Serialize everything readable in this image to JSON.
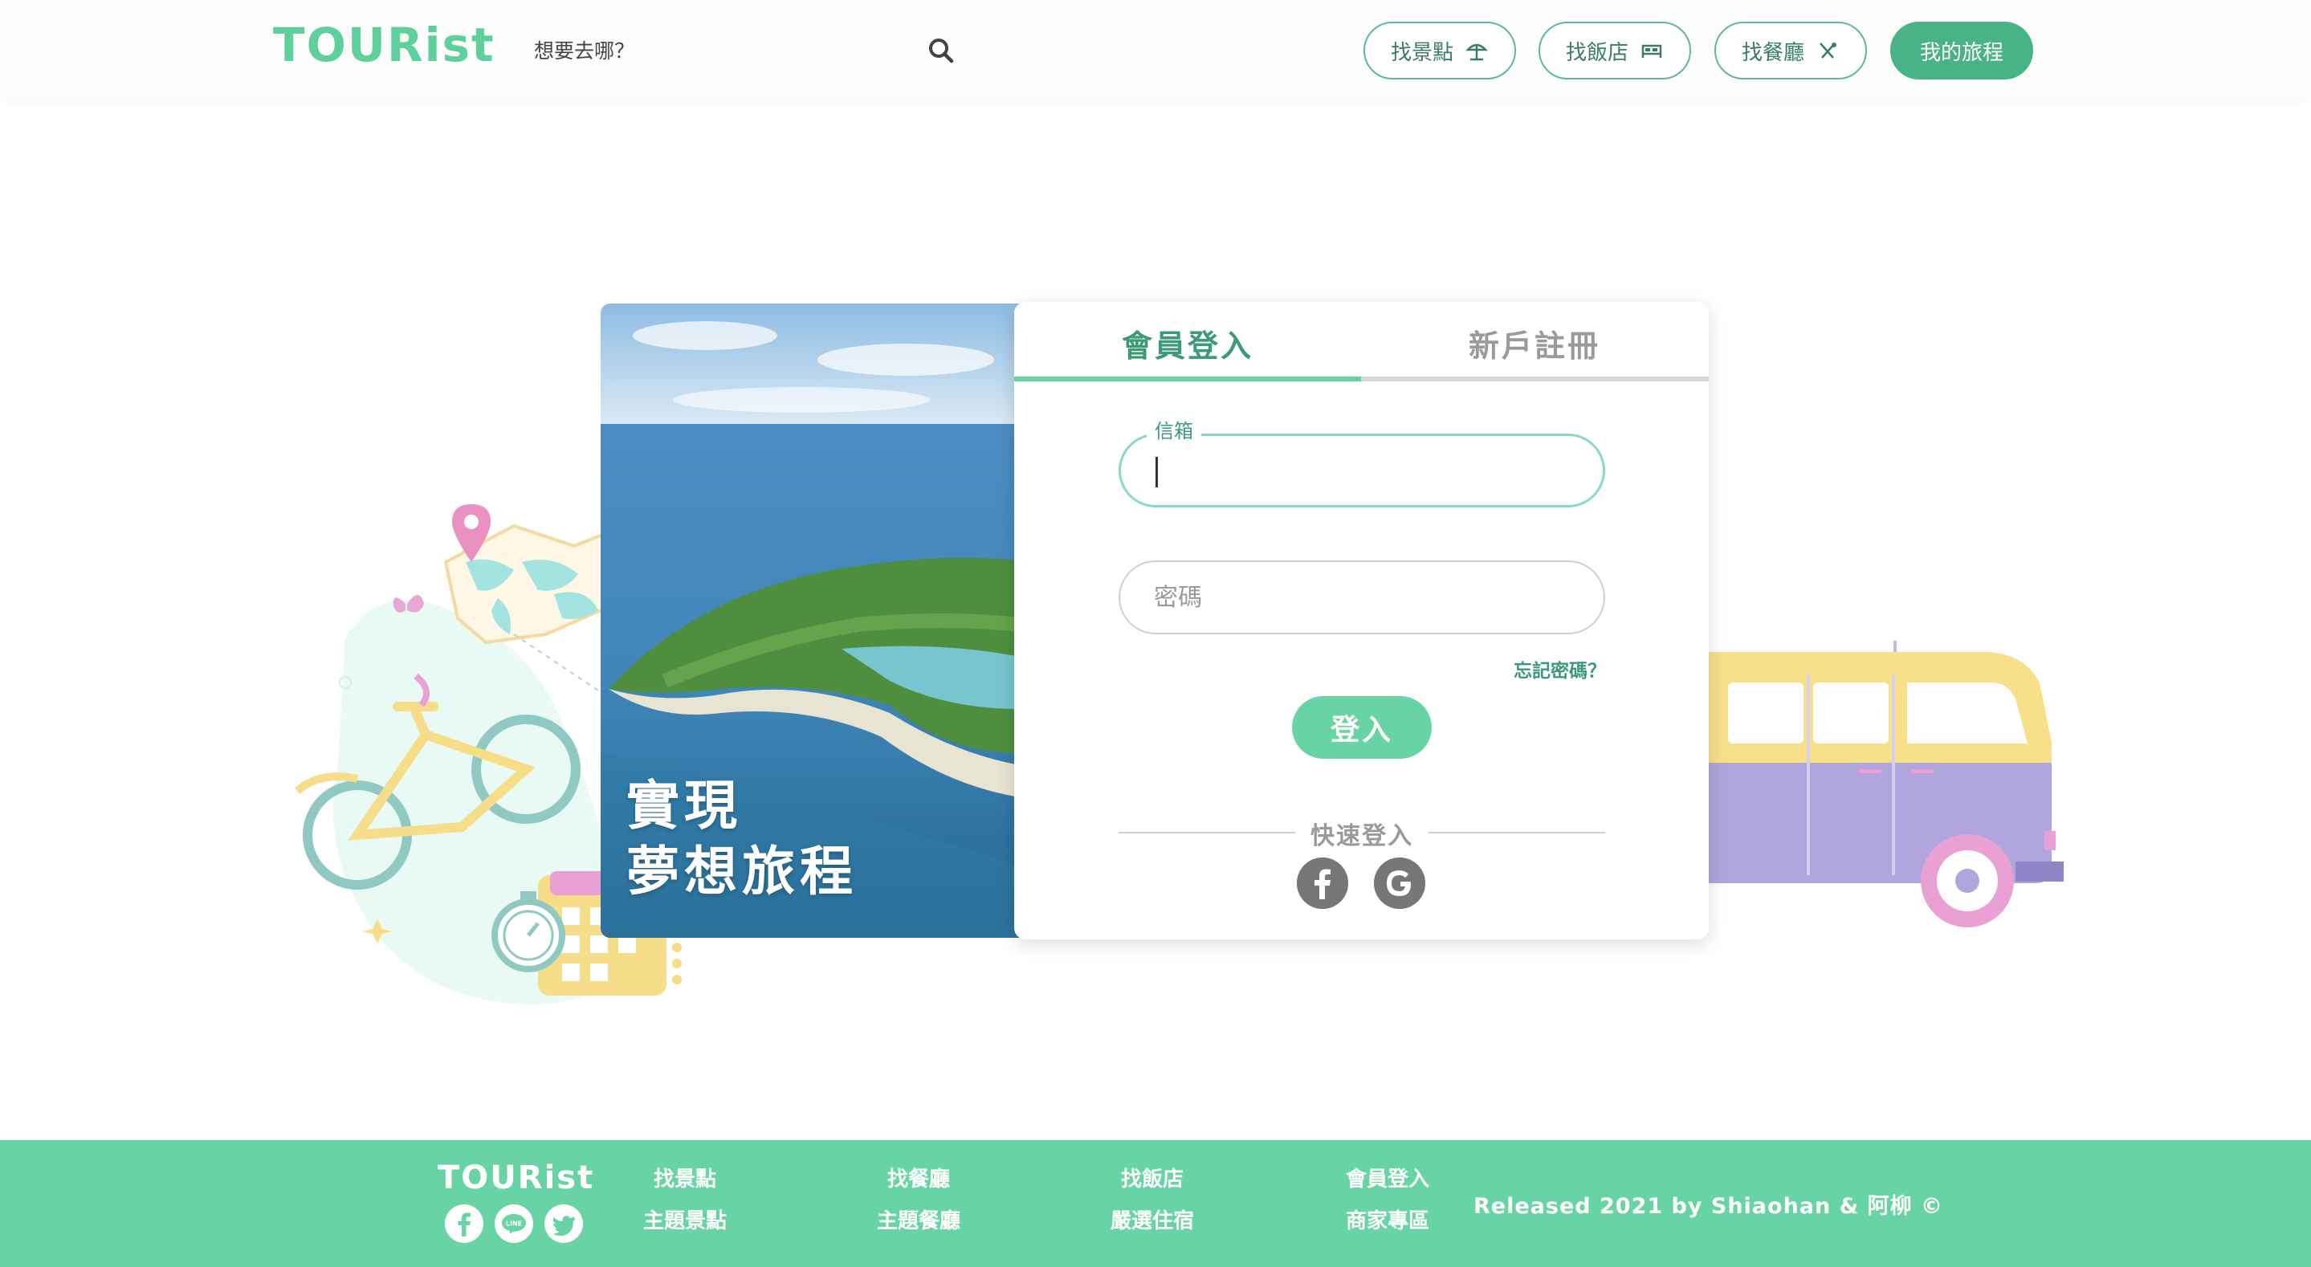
{
  "header": {
    "logo": "TOURist",
    "search_placeholder": "想要去哪？",
    "nav": [
      {
        "label": "找景點",
        "icon": "beach-umbrella-icon"
      },
      {
        "label": "找飯店",
        "icon": "bed-icon"
      },
      {
        "label": "找餐廳",
        "icon": "utensils-icon"
      },
      {
        "label": "我的旅程"
      }
    ]
  },
  "hero": {
    "caption_line1": "實現",
    "caption_line2": "夢想旅程"
  },
  "login": {
    "tabs": [
      {
        "label": "會員登入",
        "active": true
      },
      {
        "label": "新戶註冊",
        "active": false
      }
    ],
    "email_label": "信箱",
    "email_value": "",
    "password_placeholder": "密碼",
    "forgot": "忘記密碼？",
    "submit": "登入",
    "quick_login": "快速登入",
    "social": [
      "facebook-icon",
      "google-icon"
    ]
  },
  "footer": {
    "logo": "TOURist",
    "social_icons": [
      "facebook-icon",
      "line-icon",
      "twitter-icon"
    ],
    "links": [
      [
        "找景點",
        "主題景點"
      ],
      [
        "找餐廳",
        "主題餐廳"
      ],
      [
        "找飯店",
        "嚴選住宿"
      ],
      [
        "會員登入",
        "商家專區"
      ]
    ],
    "released": "Released 2021 by Shiaohan & 阿柳 ©"
  },
  "colors": {
    "brand_green": "#5fcf9c",
    "dark_green": "#3d9a77",
    "footer_green": "#68d4a5",
    "button_green": "#49b287"
  }
}
